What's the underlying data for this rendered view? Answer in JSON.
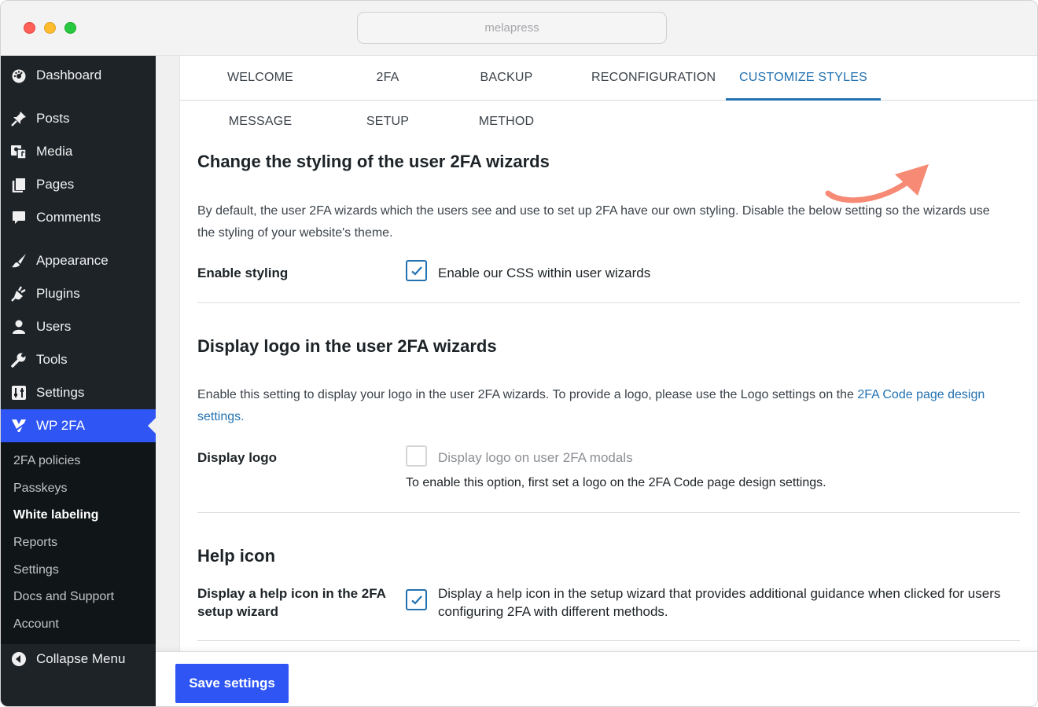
{
  "browser": {
    "url": "melapress"
  },
  "sidebar": {
    "items": [
      {
        "label": "Dashboard",
        "icon": "dashboard-icon"
      },
      {
        "label": "Posts",
        "icon": "pin-icon"
      },
      {
        "label": "Media",
        "icon": "media-icon"
      },
      {
        "label": "Pages",
        "icon": "pages-icon"
      },
      {
        "label": "Comments",
        "icon": "comment-icon"
      },
      {
        "label": "Appearance",
        "icon": "brush-icon"
      },
      {
        "label": "Plugins",
        "icon": "plug-icon"
      },
      {
        "label": "Users",
        "icon": "user-icon"
      },
      {
        "label": "Tools",
        "icon": "wrench-icon"
      },
      {
        "label": "Settings",
        "icon": "settings-icon"
      },
      {
        "label": "WP 2FA",
        "icon": "wp2fa-icon",
        "active": true
      }
    ],
    "submenu": [
      "2FA policies",
      "Passkeys",
      "White labeling",
      "Reports",
      "Settings",
      "Docs and Support",
      "Account"
    ],
    "submenu_current": "White labeling",
    "collapse_label": "Collapse Menu"
  },
  "tabs": [
    "WELCOME MESSAGE",
    "2FA SETUP",
    "BACKUP METHOD",
    "RECONFIGURATION",
    "CUSTOMIZE STYLES"
  ],
  "active_tab": "CUSTOMIZE STYLES",
  "sections": {
    "styling": {
      "title": "Change the styling of the user 2FA wizards",
      "description": "By default, the user 2FA wizards which the users see and use to set up 2FA have our own styling. Disable the below setting so the wizards use the styling of your website's theme.",
      "label": "Enable styling",
      "checkbox_label": "Enable our CSS within user wizards",
      "checked": true
    },
    "logo": {
      "title": "Display logo in the user 2FA wizards",
      "description": "Enable this setting to display your logo in the user 2FA wizards. To provide a logo, please use the Logo settings on the ",
      "link_text": "2FA Code page design settings.",
      "label": "Display logo",
      "checkbox_label": "Display logo on user 2FA modals",
      "checked": false,
      "disabled": true,
      "note": "To enable this option, first set a logo on the 2FA Code page design settings."
    },
    "help": {
      "title": "Help icon",
      "label": "Display a help icon in the 2FA setup wizard",
      "checkbox_label": "Display a help icon in the setup wizard that provides additional guidance when clicked for users configuring 2FA with different methods.",
      "checked": true
    }
  },
  "footer": {
    "save_label": "Save settings"
  },
  "colors": {
    "accent": "#2f56f5",
    "link": "#2271b1",
    "sidebar_bg": "#1d2327",
    "annotation_arrow": "#f68a75"
  }
}
